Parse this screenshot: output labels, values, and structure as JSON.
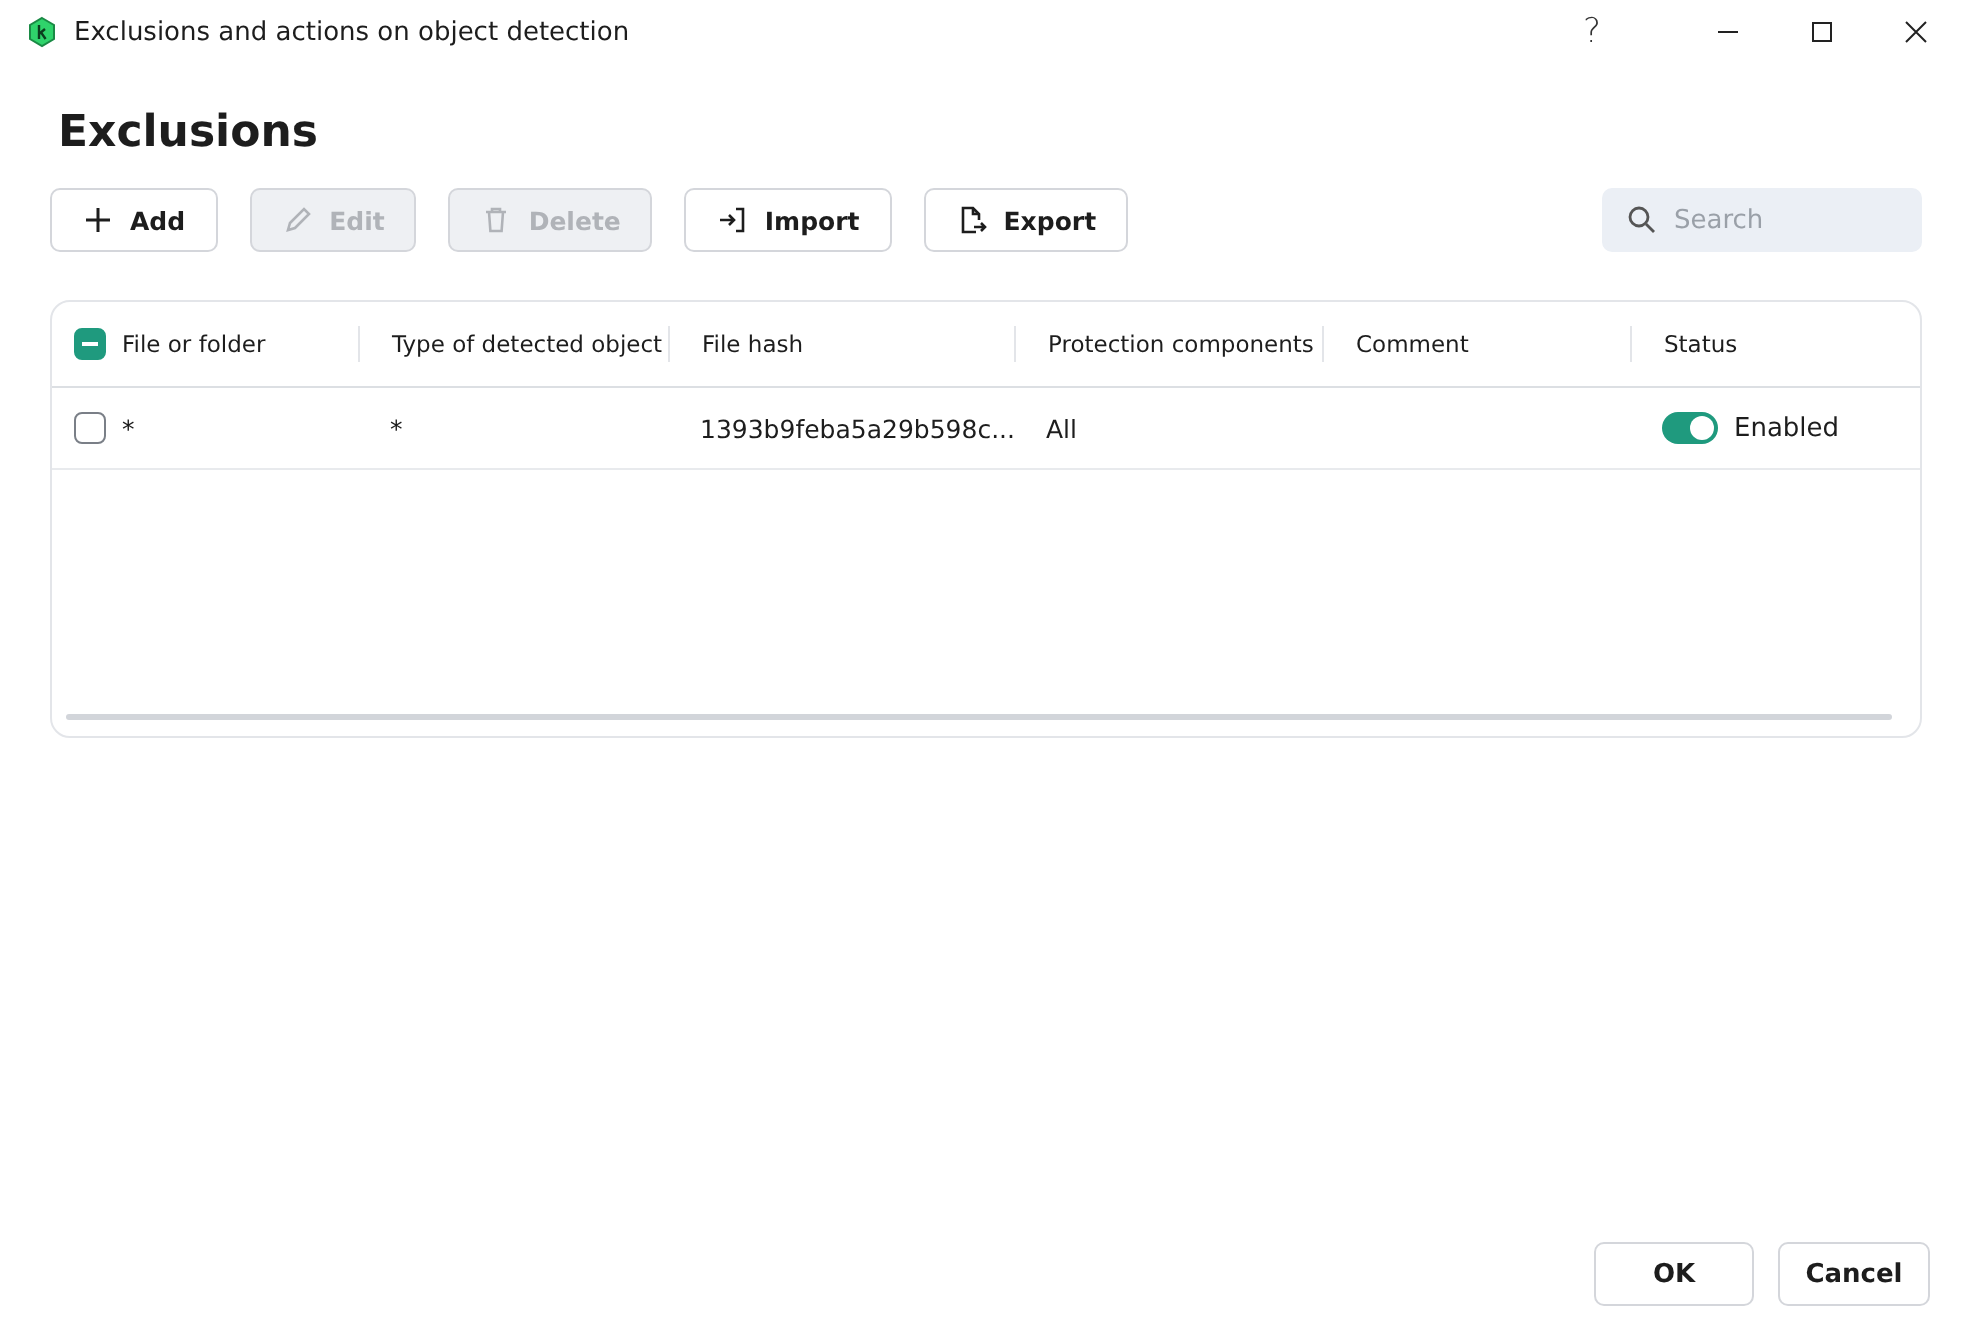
{
  "window": {
    "title": "Exclusions and actions on object detection",
    "controls": [
      "?"
    ]
  },
  "heading": "Exclusions",
  "toolbar": [
    {
      "label": "Add",
      "kind": "add",
      "disabled": false
    },
    {
      "label": "Edit",
      "kind": "edit",
      "disabled": true
    },
    {
      "label": "Delete",
      "kind": "delete",
      "disabled": true
    },
    {
      "label": "Import",
      "kind": "import",
      "disabled": false
    },
    {
      "label": "Export",
      "kind": "export",
      "disabled": false
    }
  ],
  "search": {
    "placeholder": "Search"
  },
  "table": {
    "select_all": {
      "indeterminate": true
    },
    "columns": [
      "File or folder",
      "Type of detected object",
      "File hash",
      "Protection components",
      "Comment",
      "Status"
    ],
    "rows": [
      {
        "checked": false,
        "file": "*",
        "type": "*",
        "hash": "1393b9feba5a29b598c...",
        "components": "All",
        "status": {
          "on": true,
          "label": "Enabled"
        }
      }
    ]
  },
  "buttons": [
    "OK",
    "Cancel"
  ]
}
